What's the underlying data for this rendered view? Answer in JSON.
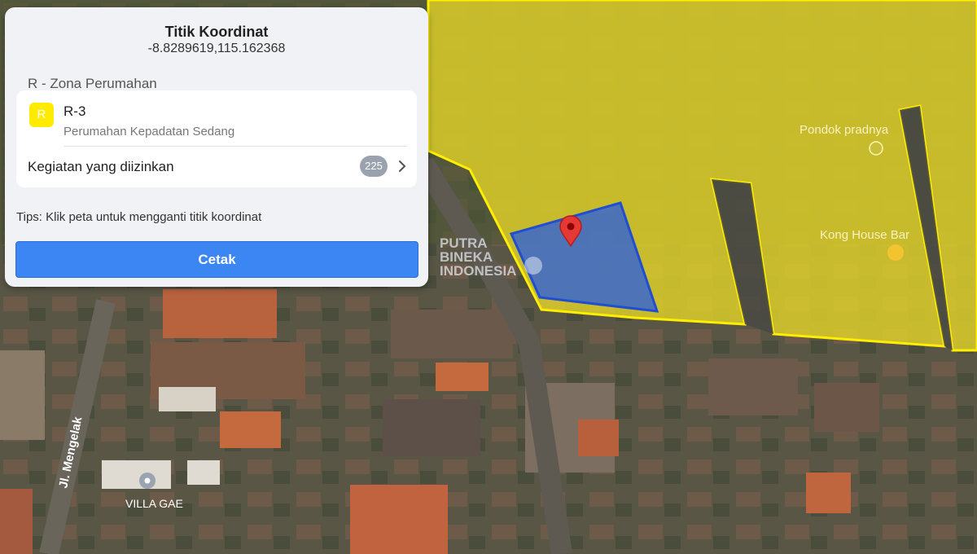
{
  "panel": {
    "title": "Titik Koordinat",
    "coordinates": "-8.8289619,115.162368",
    "zone_label": "R - Zona Perumahan",
    "zone": {
      "badge": "R",
      "code": "R-3",
      "description": "Perumahan Kepadatan Sedang"
    },
    "activity": {
      "label": "Kegiatan yang diizinkan",
      "count": "225"
    },
    "tips": "Tips: Klik peta untuk mengganti titik koordinat",
    "print_button": "Cetak"
  },
  "map": {
    "places": {
      "pondok": "Pondok pradnya",
      "kong": "Kong House Bar",
      "villa": "VILLA GAE"
    },
    "street": "Jl. Mengelak",
    "watermark": [
      "PUTRA",
      "BINEKA",
      "INDONESIA"
    ]
  },
  "colors": {
    "zone_fill": "#e0d22a",
    "zone_border": "#ffee00",
    "selected_parcel": "#2f62d8",
    "pin": "#e53935",
    "accent": "#3b86f2",
    "place_label": "#f4d35e"
  }
}
